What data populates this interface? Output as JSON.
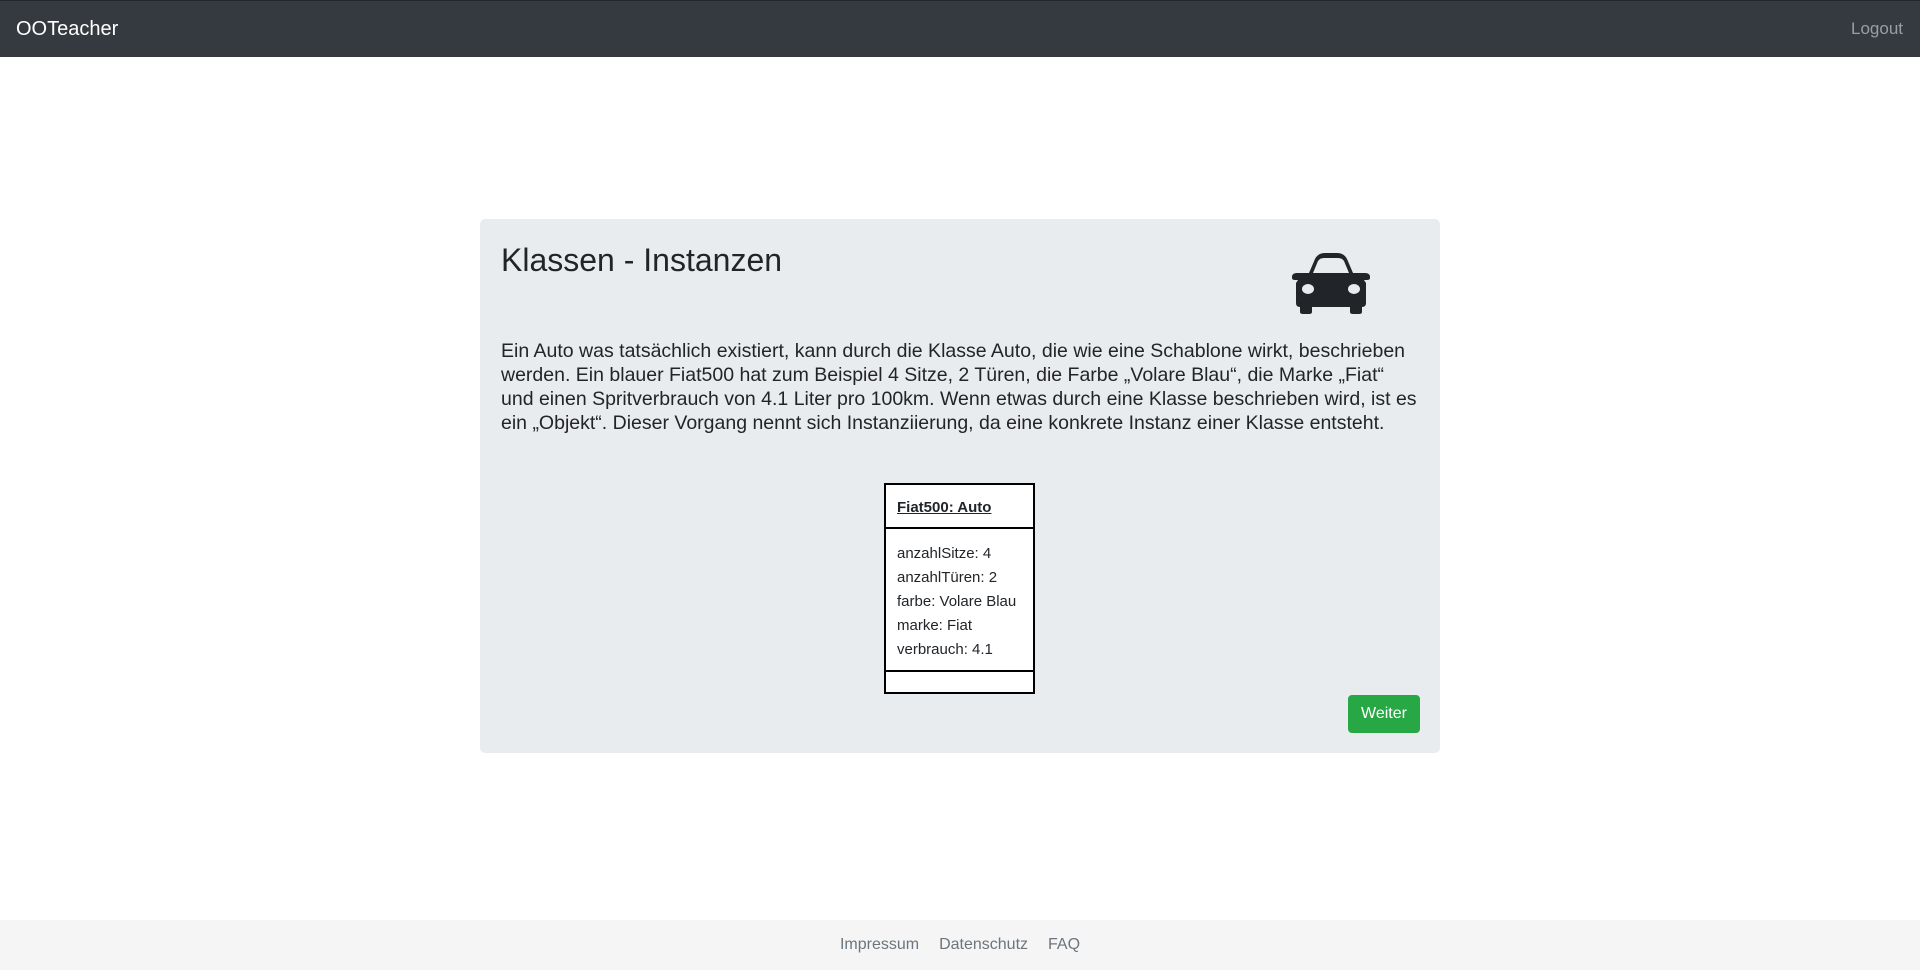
{
  "navbar": {
    "brand": "OOTeacher",
    "logout": "Logout"
  },
  "card": {
    "title": "Klassen - Instanzen",
    "icon": "car-icon",
    "text": "Ein Auto was tatsächlich existiert, kann durch die Klasse Auto, die wie eine Schablone wirkt, beschrieben werden. Ein blauer Fiat500 hat zum Beispiel 4 Sitze, 2 Türen, die Farbe „Volare Blau“, die Marke „Fiat“ und einen Spritverbrauch von 4.1 Liter pro 100km. Wenn etwas durch eine Klasse beschrieben wird, ist es ein „Objekt“. Dieser Vorgang nennt sich Instanziierung, da eine konkrete Instanz einer Klasse entsteht.",
    "button": "Weiter"
  },
  "uml": {
    "name": "Fiat500: Auto",
    "attributes": [
      "anzahlSitze: 4",
      "anzahlTüren: 2",
      "farbe: Volare Blau",
      "marke: Fiat",
      "verbrauch: 4.1"
    ]
  },
  "footer": {
    "links": [
      "Impressum",
      "Datenschutz",
      "FAQ"
    ]
  }
}
